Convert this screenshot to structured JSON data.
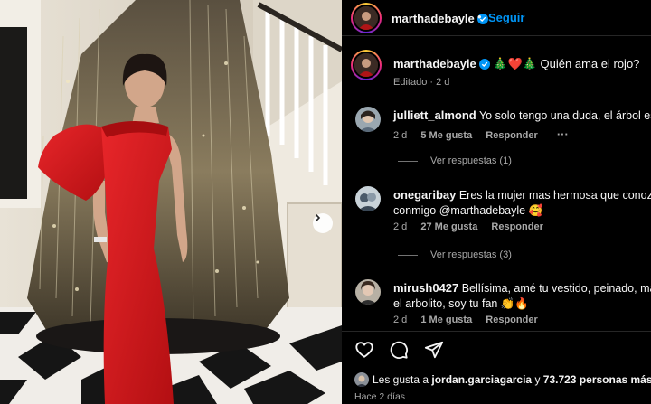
{
  "post": {
    "username": "marthadebayle",
    "follow_label": "Seguir",
    "header_dot": "•",
    "caption_text": "🎄❤️🎄 Quién ama el rojo?",
    "caption_meta": "Editado · 2 d"
  },
  "comments": [
    {
      "username": "julliett_almond",
      "text_line1": "Yo solo tengo una duda, el árbol es r",
      "text_line2": "",
      "time": "2 d",
      "likes": "5 Me gusta",
      "reply_label": "Responder",
      "more": "···",
      "view_replies": "Ver respuestas (1)"
    },
    {
      "username": "onegaribay",
      "text_line1": "Eres la mujer mas hermosa que conozco",
      "text_line2": "conmigo @marthadebayle 🥰",
      "time": "2 d",
      "likes": "27 Me gusta",
      "reply_label": "Responder",
      "more": "",
      "view_replies": "Ver respuestas (3)"
    },
    {
      "username": "mirush0427",
      "text_line1": "Bellísima, amé tu vestido, peinado, maq",
      "text_line2": "el arbolito, soy tu fan 👏🔥",
      "time": "2 d",
      "likes": "1 Me gusta",
      "reply_label": "Responder",
      "more": "",
      "view_replies": ""
    }
  ],
  "likes": {
    "prefix": "Les gusta a ",
    "user": "jordan.garciagarcia",
    "middle": " y ",
    "count": "73.723 personas más"
  },
  "posted_ago": "Hace 2 días",
  "icons": [
    "verified-badge-icon",
    "heart-icon",
    "comment-icon",
    "share-icon",
    "chevron-right-icon"
  ],
  "colors": {
    "accent": "#0095f6",
    "background": "#000000",
    "muted": "#a8a8a8",
    "dress_red": "#d01518"
  }
}
